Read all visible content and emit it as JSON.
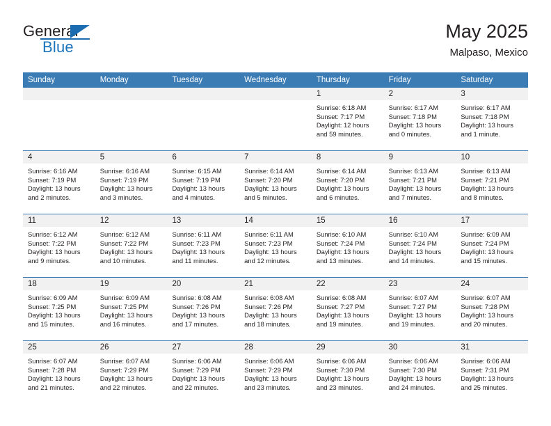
{
  "brand": {
    "word_one": "General",
    "word_two": "Blue",
    "flag_icon": "triangle-flag-icon"
  },
  "header": {
    "title": "May 2025",
    "subtitle": "Malpaso, Mexico"
  },
  "calendar": {
    "weekdays": [
      "Sunday",
      "Monday",
      "Tuesday",
      "Wednesday",
      "Thursday",
      "Friday",
      "Saturday"
    ],
    "accent_color": "#3c7cb5",
    "day_band_color": "#f1f1f1",
    "weeks": [
      [
        {
          "day": "",
          "sunrise": "",
          "sunset": "",
          "daylight": ""
        },
        {
          "day": "",
          "sunrise": "",
          "sunset": "",
          "daylight": ""
        },
        {
          "day": "",
          "sunrise": "",
          "sunset": "",
          "daylight": ""
        },
        {
          "day": "",
          "sunrise": "",
          "sunset": "",
          "daylight": ""
        },
        {
          "day": "1",
          "sunrise": "Sunrise: 6:18 AM",
          "sunset": "Sunset: 7:17 PM",
          "daylight": "Daylight: 12 hours and 59 minutes."
        },
        {
          "day": "2",
          "sunrise": "Sunrise: 6:17 AM",
          "sunset": "Sunset: 7:18 PM",
          "daylight": "Daylight: 13 hours and 0 minutes."
        },
        {
          "day": "3",
          "sunrise": "Sunrise: 6:17 AM",
          "sunset": "Sunset: 7:18 PM",
          "daylight": "Daylight: 13 hours and 1 minute."
        }
      ],
      [
        {
          "day": "4",
          "sunrise": "Sunrise: 6:16 AM",
          "sunset": "Sunset: 7:19 PM",
          "daylight": "Daylight: 13 hours and 2 minutes."
        },
        {
          "day": "5",
          "sunrise": "Sunrise: 6:16 AM",
          "sunset": "Sunset: 7:19 PM",
          "daylight": "Daylight: 13 hours and 3 minutes."
        },
        {
          "day": "6",
          "sunrise": "Sunrise: 6:15 AM",
          "sunset": "Sunset: 7:19 PM",
          "daylight": "Daylight: 13 hours and 4 minutes."
        },
        {
          "day": "7",
          "sunrise": "Sunrise: 6:14 AM",
          "sunset": "Sunset: 7:20 PM",
          "daylight": "Daylight: 13 hours and 5 minutes."
        },
        {
          "day": "8",
          "sunrise": "Sunrise: 6:14 AM",
          "sunset": "Sunset: 7:20 PM",
          "daylight": "Daylight: 13 hours and 6 minutes."
        },
        {
          "day": "9",
          "sunrise": "Sunrise: 6:13 AM",
          "sunset": "Sunset: 7:21 PM",
          "daylight": "Daylight: 13 hours and 7 minutes."
        },
        {
          "day": "10",
          "sunrise": "Sunrise: 6:13 AM",
          "sunset": "Sunset: 7:21 PM",
          "daylight": "Daylight: 13 hours and 8 minutes."
        }
      ],
      [
        {
          "day": "11",
          "sunrise": "Sunrise: 6:12 AM",
          "sunset": "Sunset: 7:22 PM",
          "daylight": "Daylight: 13 hours and 9 minutes."
        },
        {
          "day": "12",
          "sunrise": "Sunrise: 6:12 AM",
          "sunset": "Sunset: 7:22 PM",
          "daylight": "Daylight: 13 hours and 10 minutes."
        },
        {
          "day": "13",
          "sunrise": "Sunrise: 6:11 AM",
          "sunset": "Sunset: 7:23 PM",
          "daylight": "Daylight: 13 hours and 11 minutes."
        },
        {
          "day": "14",
          "sunrise": "Sunrise: 6:11 AM",
          "sunset": "Sunset: 7:23 PM",
          "daylight": "Daylight: 13 hours and 12 minutes."
        },
        {
          "day": "15",
          "sunrise": "Sunrise: 6:10 AM",
          "sunset": "Sunset: 7:24 PM",
          "daylight": "Daylight: 13 hours and 13 minutes."
        },
        {
          "day": "16",
          "sunrise": "Sunrise: 6:10 AM",
          "sunset": "Sunset: 7:24 PM",
          "daylight": "Daylight: 13 hours and 14 minutes."
        },
        {
          "day": "17",
          "sunrise": "Sunrise: 6:09 AM",
          "sunset": "Sunset: 7:24 PM",
          "daylight": "Daylight: 13 hours and 15 minutes."
        }
      ],
      [
        {
          "day": "18",
          "sunrise": "Sunrise: 6:09 AM",
          "sunset": "Sunset: 7:25 PM",
          "daylight": "Daylight: 13 hours and 15 minutes."
        },
        {
          "day": "19",
          "sunrise": "Sunrise: 6:09 AM",
          "sunset": "Sunset: 7:25 PM",
          "daylight": "Daylight: 13 hours and 16 minutes."
        },
        {
          "day": "20",
          "sunrise": "Sunrise: 6:08 AM",
          "sunset": "Sunset: 7:26 PM",
          "daylight": "Daylight: 13 hours and 17 minutes."
        },
        {
          "day": "21",
          "sunrise": "Sunrise: 6:08 AM",
          "sunset": "Sunset: 7:26 PM",
          "daylight": "Daylight: 13 hours and 18 minutes."
        },
        {
          "day": "22",
          "sunrise": "Sunrise: 6:08 AM",
          "sunset": "Sunset: 7:27 PM",
          "daylight": "Daylight: 13 hours and 19 minutes."
        },
        {
          "day": "23",
          "sunrise": "Sunrise: 6:07 AM",
          "sunset": "Sunset: 7:27 PM",
          "daylight": "Daylight: 13 hours and 19 minutes."
        },
        {
          "day": "24",
          "sunrise": "Sunrise: 6:07 AM",
          "sunset": "Sunset: 7:28 PM",
          "daylight": "Daylight: 13 hours and 20 minutes."
        }
      ],
      [
        {
          "day": "25",
          "sunrise": "Sunrise: 6:07 AM",
          "sunset": "Sunset: 7:28 PM",
          "daylight": "Daylight: 13 hours and 21 minutes."
        },
        {
          "day": "26",
          "sunrise": "Sunrise: 6:07 AM",
          "sunset": "Sunset: 7:29 PM",
          "daylight": "Daylight: 13 hours and 22 minutes."
        },
        {
          "day": "27",
          "sunrise": "Sunrise: 6:06 AM",
          "sunset": "Sunset: 7:29 PM",
          "daylight": "Daylight: 13 hours and 22 minutes."
        },
        {
          "day": "28",
          "sunrise": "Sunrise: 6:06 AM",
          "sunset": "Sunset: 7:29 PM",
          "daylight": "Daylight: 13 hours and 23 minutes."
        },
        {
          "day": "29",
          "sunrise": "Sunrise: 6:06 AM",
          "sunset": "Sunset: 7:30 PM",
          "daylight": "Daylight: 13 hours and 23 minutes."
        },
        {
          "day": "30",
          "sunrise": "Sunrise: 6:06 AM",
          "sunset": "Sunset: 7:30 PM",
          "daylight": "Daylight: 13 hours and 24 minutes."
        },
        {
          "day": "31",
          "sunrise": "Sunrise: 6:06 AM",
          "sunset": "Sunset: 7:31 PM",
          "daylight": "Daylight: 13 hours and 25 minutes."
        }
      ]
    ]
  }
}
